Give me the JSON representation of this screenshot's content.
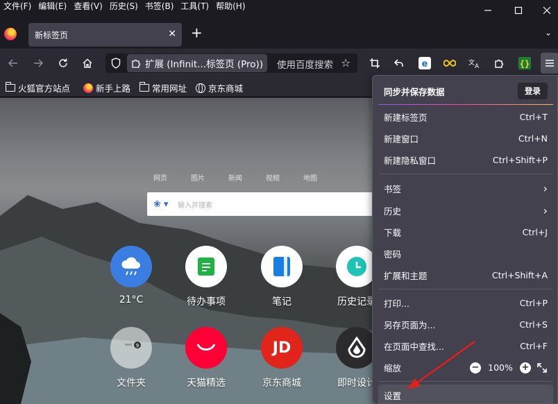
{
  "menubar": [
    "文件(F)",
    "编辑(E)",
    "查看(V)",
    "历史(S)",
    "书签(B)",
    "工具(T)",
    "帮助(H)"
  ],
  "tab": {
    "title": "新标签页"
  },
  "navbar": {
    "extension_chip": "扩展 (Infinit...标签页 (Pro))",
    "url_placeholder": "使用百度搜索"
  },
  "bookmarks": [
    "火狐官方站点",
    "新手上路",
    "常用网址",
    "京东商城"
  ],
  "page": {
    "search_tabs": [
      "网页",
      "图片",
      "新闻",
      "视频",
      "地图"
    ],
    "search_placeholder": "输入并搜索",
    "tiles_row1": [
      "21°C",
      "待办事项",
      "笔记",
      "历史记录"
    ],
    "tiles_row2": [
      "文件夹",
      "天猫精选",
      "京东商城",
      "即时设计"
    ],
    "tile_icons_row1": [
      "weather-icon",
      "todo-icon",
      "notes-icon",
      "history-clock-icon"
    ],
    "tile_icons_row2": [
      "folder-icon",
      "tmall-icon",
      "jd-icon",
      "jishi-design-icon"
    ],
    "jd_logo": "JD"
  },
  "appmenu": {
    "sync_title": "同步并保存数据",
    "login": "登录",
    "items": [
      {
        "label": "新建标签页",
        "shortcut": "Ctrl+T"
      },
      {
        "label": "新建窗口",
        "shortcut": "Ctrl+N"
      },
      {
        "label": "新建隐私窗口",
        "shortcut": "Ctrl+Shift+P"
      },
      {
        "label": "书签",
        "shortcut": ""
      },
      {
        "label": "历史",
        "shortcut": ""
      },
      {
        "label": "下载",
        "shortcut": "Ctrl+J"
      },
      {
        "label": "密码",
        "shortcut": ""
      },
      {
        "label": "扩展和主题",
        "shortcut": "Ctrl+Shift+A"
      },
      {
        "label": "打印...",
        "shortcut": "Ctrl+P"
      },
      {
        "label": "另存页面为...",
        "shortcut": "Ctrl+S"
      },
      {
        "label": "在页面中查找...",
        "shortcut": "Ctrl+F"
      }
    ],
    "zoom_label": "缩放",
    "zoom_value": "100%",
    "settings": "设置"
  },
  "colors": {
    "accent_annotation": "#e0201b",
    "menu_bg": "#42414d",
    "toolbar_bg": "#2b2a33"
  }
}
